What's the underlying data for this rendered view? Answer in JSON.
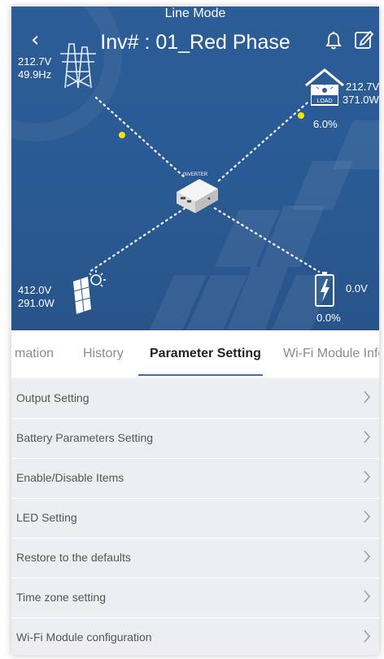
{
  "header": {
    "back_icon": "chevron-left-icon",
    "title": "Inv# : 01_Red Phase",
    "bell_icon": "bell-icon",
    "edit_icon": "edit-icon"
  },
  "status": {
    "mode": "Line Mode"
  },
  "grid": {
    "voltage": "212.7V",
    "frequency": "49.9Hz",
    "icon": "power-tower-icon"
  },
  "load": {
    "icon_label": "LOAD",
    "voltage": "212.7V",
    "power": "371.0W",
    "percent": "6.0%"
  },
  "inverter": {
    "label": "INVERTER"
  },
  "pv": {
    "voltage": "412.0V",
    "power": "291.0W",
    "icon": "solar-panel-icon"
  },
  "battery": {
    "voltage": "0.0V",
    "percent": "0.0%",
    "icon": "battery-charging-icon"
  },
  "tabs": [
    {
      "label": "mation",
      "active": false
    },
    {
      "label": "History",
      "active": false
    },
    {
      "label": "Parameter Setting",
      "active": true
    },
    {
      "label": "Wi-Fi Module Infor",
      "active": false
    }
  ],
  "menu": [
    {
      "label": "Output Setting"
    },
    {
      "label": "Battery Parameters Setting"
    },
    {
      "label": "Enable/Disable Items"
    },
    {
      "label": "LED Setting"
    },
    {
      "label": "Restore to the defaults"
    },
    {
      "label": "Time zone setting"
    },
    {
      "label": "Wi-Fi Module configuration"
    }
  ],
  "colors": {
    "hero_bg": "#2d5d96",
    "accent": "#3d6ea8",
    "flow_dot": "#f2e600"
  }
}
